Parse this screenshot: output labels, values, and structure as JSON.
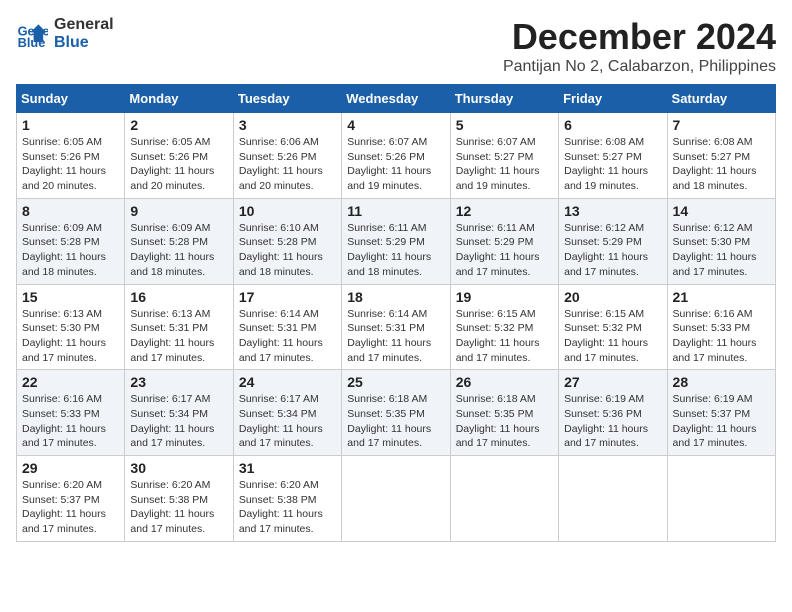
{
  "header": {
    "logo_line1": "General",
    "logo_line2": "Blue",
    "month_title": "December 2024",
    "location": "Pantijan No 2, Calabarzon, Philippines"
  },
  "weekdays": [
    "Sunday",
    "Monday",
    "Tuesday",
    "Wednesday",
    "Thursday",
    "Friday",
    "Saturday"
  ],
  "weeks": [
    [
      {
        "day": "1",
        "info": "Sunrise: 6:05 AM\nSunset: 5:26 PM\nDaylight: 11 hours\nand 20 minutes."
      },
      {
        "day": "2",
        "info": "Sunrise: 6:05 AM\nSunset: 5:26 PM\nDaylight: 11 hours\nand 20 minutes."
      },
      {
        "day": "3",
        "info": "Sunrise: 6:06 AM\nSunset: 5:26 PM\nDaylight: 11 hours\nand 20 minutes."
      },
      {
        "day": "4",
        "info": "Sunrise: 6:07 AM\nSunset: 5:26 PM\nDaylight: 11 hours\nand 19 minutes."
      },
      {
        "day": "5",
        "info": "Sunrise: 6:07 AM\nSunset: 5:27 PM\nDaylight: 11 hours\nand 19 minutes."
      },
      {
        "day": "6",
        "info": "Sunrise: 6:08 AM\nSunset: 5:27 PM\nDaylight: 11 hours\nand 19 minutes."
      },
      {
        "day": "7",
        "info": "Sunrise: 6:08 AM\nSunset: 5:27 PM\nDaylight: 11 hours\nand 18 minutes."
      }
    ],
    [
      {
        "day": "8",
        "info": "Sunrise: 6:09 AM\nSunset: 5:28 PM\nDaylight: 11 hours\nand 18 minutes."
      },
      {
        "day": "9",
        "info": "Sunrise: 6:09 AM\nSunset: 5:28 PM\nDaylight: 11 hours\nand 18 minutes."
      },
      {
        "day": "10",
        "info": "Sunrise: 6:10 AM\nSunset: 5:28 PM\nDaylight: 11 hours\nand 18 minutes."
      },
      {
        "day": "11",
        "info": "Sunrise: 6:11 AM\nSunset: 5:29 PM\nDaylight: 11 hours\nand 18 minutes."
      },
      {
        "day": "12",
        "info": "Sunrise: 6:11 AM\nSunset: 5:29 PM\nDaylight: 11 hours\nand 17 minutes."
      },
      {
        "day": "13",
        "info": "Sunrise: 6:12 AM\nSunset: 5:29 PM\nDaylight: 11 hours\nand 17 minutes."
      },
      {
        "day": "14",
        "info": "Sunrise: 6:12 AM\nSunset: 5:30 PM\nDaylight: 11 hours\nand 17 minutes."
      }
    ],
    [
      {
        "day": "15",
        "info": "Sunrise: 6:13 AM\nSunset: 5:30 PM\nDaylight: 11 hours\nand 17 minutes."
      },
      {
        "day": "16",
        "info": "Sunrise: 6:13 AM\nSunset: 5:31 PM\nDaylight: 11 hours\nand 17 minutes."
      },
      {
        "day": "17",
        "info": "Sunrise: 6:14 AM\nSunset: 5:31 PM\nDaylight: 11 hours\nand 17 minutes."
      },
      {
        "day": "18",
        "info": "Sunrise: 6:14 AM\nSunset: 5:31 PM\nDaylight: 11 hours\nand 17 minutes."
      },
      {
        "day": "19",
        "info": "Sunrise: 6:15 AM\nSunset: 5:32 PM\nDaylight: 11 hours\nand 17 minutes."
      },
      {
        "day": "20",
        "info": "Sunrise: 6:15 AM\nSunset: 5:32 PM\nDaylight: 11 hours\nand 17 minutes."
      },
      {
        "day": "21",
        "info": "Sunrise: 6:16 AM\nSunset: 5:33 PM\nDaylight: 11 hours\nand 17 minutes."
      }
    ],
    [
      {
        "day": "22",
        "info": "Sunrise: 6:16 AM\nSunset: 5:33 PM\nDaylight: 11 hours\nand 17 minutes."
      },
      {
        "day": "23",
        "info": "Sunrise: 6:17 AM\nSunset: 5:34 PM\nDaylight: 11 hours\nand 17 minutes."
      },
      {
        "day": "24",
        "info": "Sunrise: 6:17 AM\nSunset: 5:34 PM\nDaylight: 11 hours\nand 17 minutes."
      },
      {
        "day": "25",
        "info": "Sunrise: 6:18 AM\nSunset: 5:35 PM\nDaylight: 11 hours\nand 17 minutes."
      },
      {
        "day": "26",
        "info": "Sunrise: 6:18 AM\nSunset: 5:35 PM\nDaylight: 11 hours\nand 17 minutes."
      },
      {
        "day": "27",
        "info": "Sunrise: 6:19 AM\nSunset: 5:36 PM\nDaylight: 11 hours\nand 17 minutes."
      },
      {
        "day": "28",
        "info": "Sunrise: 6:19 AM\nSunset: 5:37 PM\nDaylight: 11 hours\nand 17 minutes."
      }
    ],
    [
      {
        "day": "29",
        "info": "Sunrise: 6:20 AM\nSunset: 5:37 PM\nDaylight: 11 hours\nand 17 minutes."
      },
      {
        "day": "30",
        "info": "Sunrise: 6:20 AM\nSunset: 5:38 PM\nDaylight: 11 hours\nand 17 minutes."
      },
      {
        "day": "31",
        "info": "Sunrise: 6:20 AM\nSunset: 5:38 PM\nDaylight: 11 hours\nand 17 minutes."
      },
      null,
      null,
      null,
      null
    ]
  ]
}
